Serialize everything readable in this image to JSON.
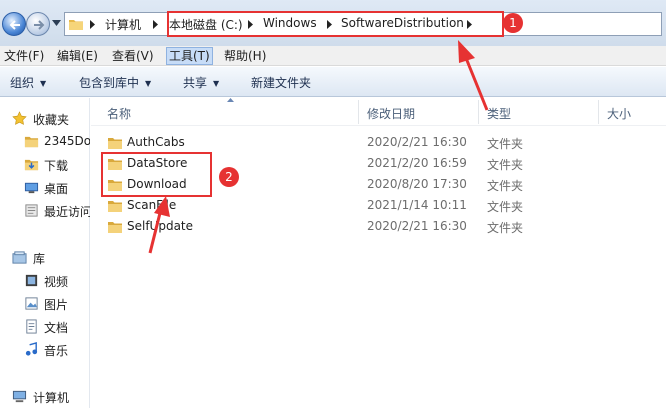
{
  "address_bar": {
    "crumbs": [
      "计算机",
      "本地磁盘 (C:)",
      "Windows",
      "SoftwareDistribution"
    ]
  },
  "menu": {
    "items": [
      "文件(F)",
      "编辑(E)",
      "查看(V)",
      "工具(T)",
      "帮助(H)"
    ],
    "active_index": 3
  },
  "commands": {
    "organize": "组织",
    "include_in_library": "包含到库中",
    "share": "共享",
    "new_folder": "新建文件夹"
  },
  "nav_pane": {
    "favorites": "收藏夹",
    "favorite_items": [
      "2345Do",
      "下载",
      "桌面",
      "最近访问"
    ],
    "libraries": "库",
    "library_items": [
      "视频",
      "图片",
      "文档",
      "音乐"
    ],
    "computer": "计算机"
  },
  "columns": {
    "name": "名称",
    "date_modified": "修改日期",
    "type": "类型",
    "size": "大小"
  },
  "files": [
    {
      "name": "AuthCabs",
      "date": "2020/2/21 16:30",
      "type": "文件夹"
    },
    {
      "name": "DataStore",
      "date": "2021/2/20 16:59",
      "type": "文件夹"
    },
    {
      "name": "Download",
      "date": "2020/8/20 17:30",
      "type": "文件夹"
    },
    {
      "name": "ScanFile",
      "date": "2021/1/14 10:11",
      "type": "文件夹"
    },
    {
      "name": "SelfUpdate",
      "date": "2020/2/21 16:30",
      "type": "文件夹"
    }
  ],
  "annotations": {
    "step1": "1",
    "step2": "2",
    "color": "#e63232"
  },
  "icons": {
    "back": "back-arrow-icon",
    "forward": "forward-arrow-icon",
    "folder": "folder-icon",
    "star": "star-icon",
    "library": "library-icon",
    "computer": "computer-icon"
  }
}
